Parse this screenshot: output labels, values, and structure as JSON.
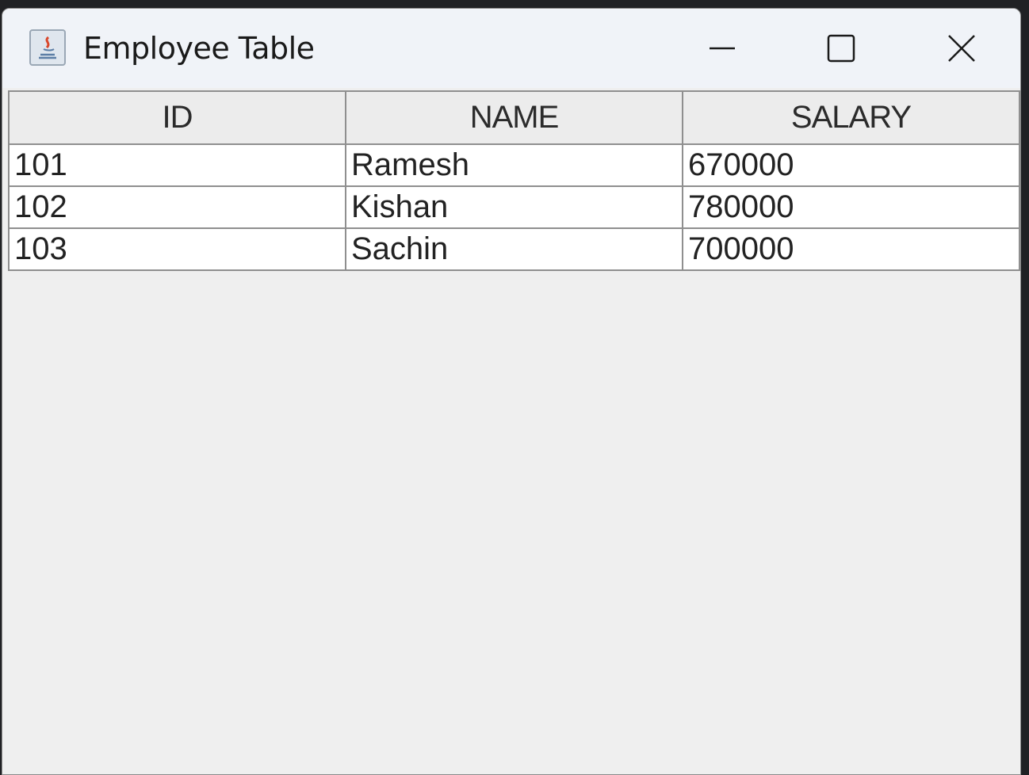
{
  "window": {
    "title": "Employee Table",
    "icon": "java-app-icon",
    "controls": {
      "minimize": "minimize-icon",
      "maximize": "maximize-icon",
      "close": "close-icon"
    }
  },
  "table": {
    "columns": [
      "ID",
      "NAME",
      "SALARY"
    ],
    "rows": [
      [
        "101",
        "Ramesh",
        "670000"
      ],
      [
        "102",
        "Kishan",
        "780000"
      ],
      [
        "103",
        "Sachin",
        "700000"
      ]
    ]
  },
  "colors": {
    "titlebar": "#f0f3f8",
    "content_background": "#efefef",
    "grid_line": "#8f8f8f",
    "cell_background": "#ffffff"
  }
}
